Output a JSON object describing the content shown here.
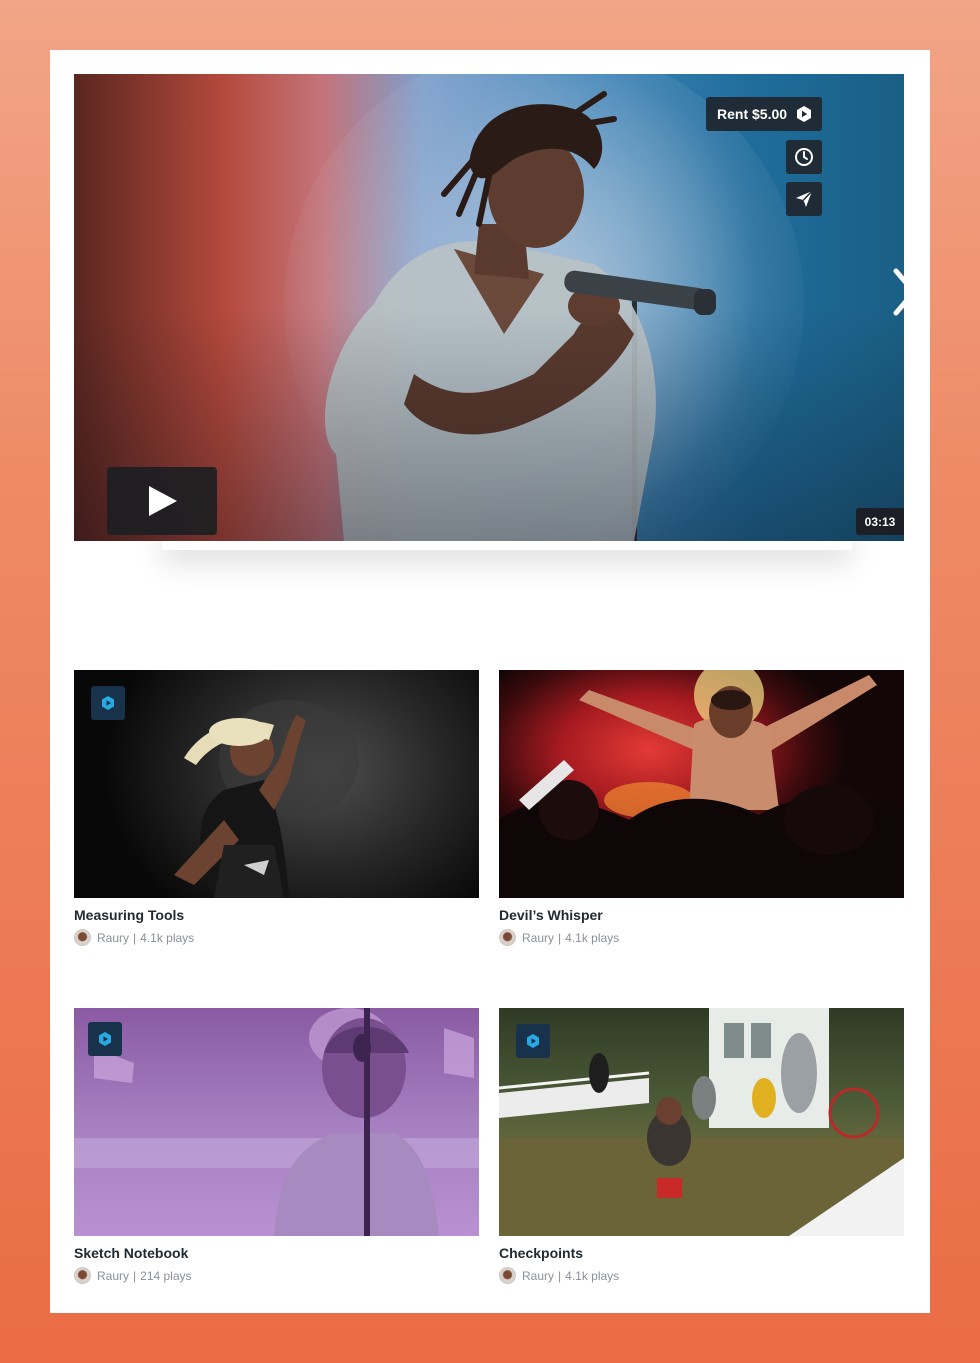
{
  "hero": {
    "rent_label": "Rent $5.00",
    "duration": "03:13",
    "icons": {
      "rent": "play-hexagon-icon",
      "watch_later": "clock-icon",
      "share": "send-icon",
      "play": "play-icon",
      "next": "chevron-right-icon"
    }
  },
  "tracks": [
    {
      "title": "Measuring Tools",
      "author": "Raury",
      "separator": "|",
      "plays": "4.1k plays",
      "badge": true
    },
    {
      "title": "Devil’s Whisper",
      "author": "Raury",
      "separator": "|",
      "plays": "4.1k plays",
      "badge": false
    },
    {
      "title": "Sketch Notebook",
      "author": "Raury",
      "separator": "|",
      "plays": "214 plays",
      "badge": true
    },
    {
      "title": "Checkpoints",
      "author": "Raury",
      "separator": "|",
      "plays": "4.1k plays",
      "badge": true
    }
  ],
  "colors": {
    "background_top": "#f2a587",
    "background_bottom": "#ea6c45",
    "button_bg": "#1f2b36",
    "badge_bg": "#17324a",
    "badge_accent": "#29a9e1",
    "title_text": "#222a31",
    "meta_text": "#8a9099"
  }
}
